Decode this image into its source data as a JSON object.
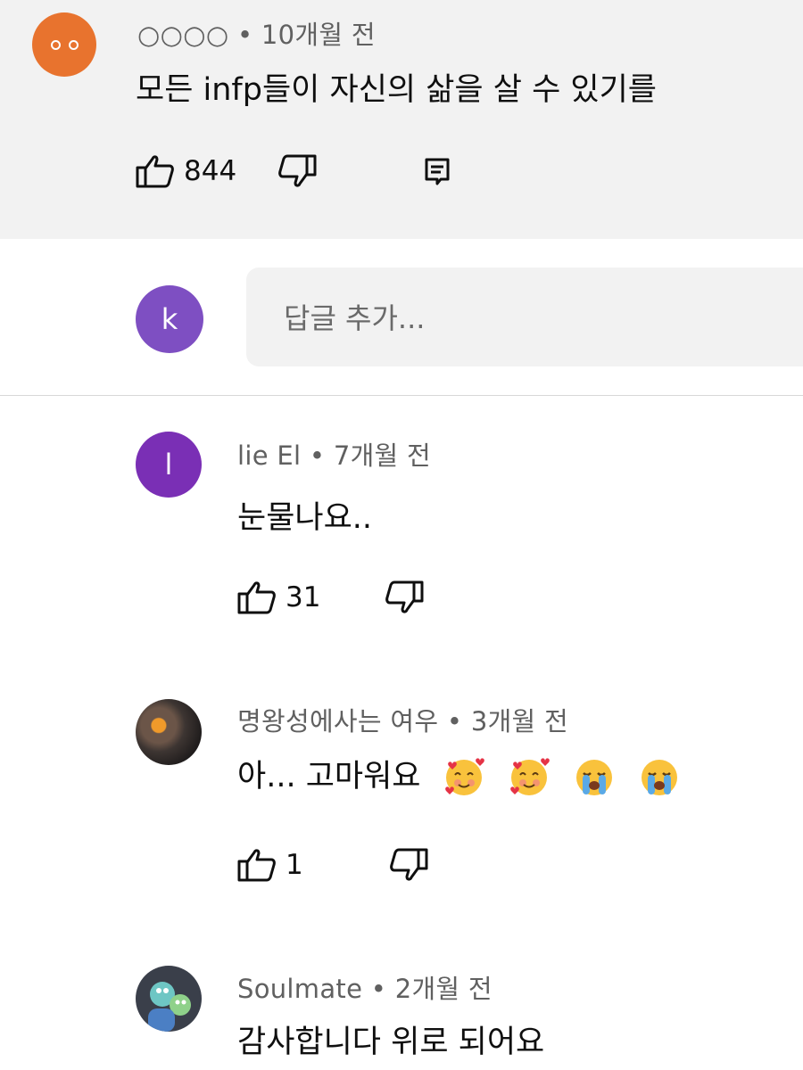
{
  "main_comment": {
    "author": "○○○○",
    "time": "10개월 전",
    "text": "모든 infp들이 자신의 삶을 살 수 있기를",
    "likes": "844",
    "avatar_color": "#e8732e"
  },
  "reply_input": {
    "avatar_letter": "k",
    "avatar_color": "#7e4fc2",
    "placeholder": "답글 추가..."
  },
  "replies": [
    {
      "author": "lie El",
      "time": "7개월 전",
      "text": "눈물나요..",
      "likes": "31",
      "avatar_letter": "l",
      "avatar_color": "#7a2fb5"
    },
    {
      "author": "명왕성에사는 여우",
      "time": "3개월 전",
      "text": "아... 고마워요",
      "emojis": [
        "smiling-face-with-hearts",
        "smiling-face-with-hearts",
        "loudly-crying-face",
        "loudly-crying-face"
      ],
      "likes": "1"
    },
    {
      "author": "Soulmate",
      "time": "2개월 전",
      "text": "감사합니다 위로 되어요"
    }
  ],
  "icons": {
    "like": "thumbs-up-icon",
    "dislike": "thumbs-down-icon",
    "reply": "reply-comment-icon"
  }
}
